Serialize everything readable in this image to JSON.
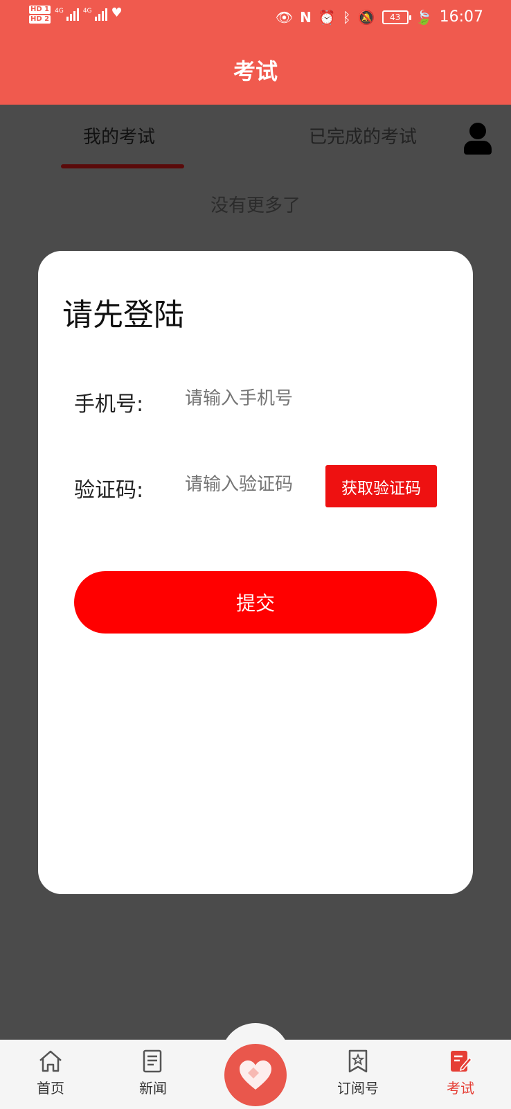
{
  "status_bar": {
    "hd1": "HD 1",
    "hd2": "HD 2",
    "net1": "4G",
    "net2": "4G",
    "battery": "43",
    "time": "16:07",
    "icons": [
      "eye-icon",
      "nfc-icon",
      "alarm-icon",
      "bluetooth-icon",
      "mute-icon",
      "leaf-icon"
    ]
  },
  "header": {
    "title": "考试"
  },
  "tabs": [
    {
      "label": "我的考试",
      "active": true
    },
    {
      "label": "已完成的考试",
      "active": false
    }
  ],
  "list": {
    "empty_text": "没有更多了"
  },
  "login_modal": {
    "title": "请先登陆",
    "phone_label": "手机号:",
    "phone_placeholder": "请输入手机号",
    "code_label": "验证码:",
    "code_placeholder": "请输入验证码",
    "get_code_label": "获取验证码",
    "submit_label": "提交"
  },
  "bottom_nav": {
    "items": [
      {
        "label": "首页",
        "icon": "home-icon"
      },
      {
        "label": "新闻",
        "icon": "news-icon"
      },
      {
        "label": "订阅号",
        "icon": "subscription-icon"
      },
      {
        "label": "考试",
        "icon": "exam-icon",
        "active": true
      }
    ],
    "center_icon": "heart-icon"
  },
  "colors": {
    "primary": "#f05a4e",
    "accent_red": "#ff0000",
    "overlay": "#4b4b4b",
    "active_tab_text": "#e53e35"
  }
}
